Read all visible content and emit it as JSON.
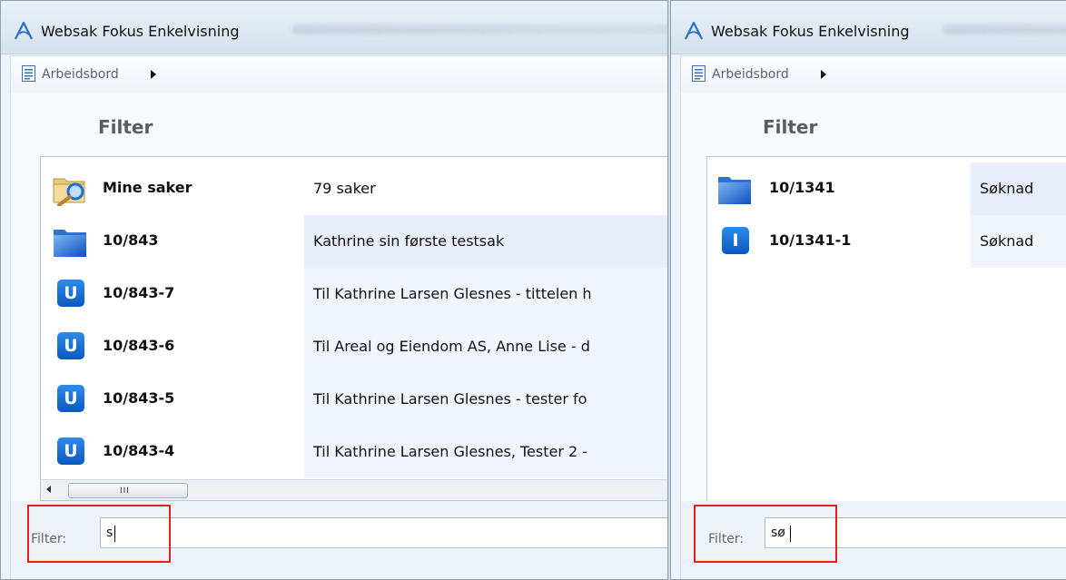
{
  "accent": "#e2231a",
  "left_window": {
    "title": "Websak Fokus Enkelvisning",
    "breadcrumb": "Arbeidsbord",
    "section_title": "Filter",
    "rows": [
      {
        "icon": "search-folder-icon",
        "number": "Mine saker",
        "description": "79 saker"
      },
      {
        "icon": "blue-folder-icon",
        "number": "10/843",
        "description": "Kathrine sin første testsak"
      },
      {
        "icon": "outgoing-document-icon",
        "badge": "U",
        "number": "10/843-7",
        "description": "Til Kathrine  Larsen Glesnes - tittelen h"
      },
      {
        "icon": "outgoing-document-icon",
        "badge": "U",
        "number": "10/843-6",
        "description": "Til Areal og Eiendom AS, Anne Lise - d"
      },
      {
        "icon": "outgoing-document-icon",
        "badge": "U",
        "number": "10/843-5",
        "description": "Til Kathrine  Larsen Glesnes - tester fo"
      },
      {
        "icon": "outgoing-document-icon",
        "badge": "U",
        "number": "10/843-4",
        "description": "Til Kathrine  Larsen Glesnes, Tester 2 -"
      }
    ],
    "scroll_grip": "III",
    "filter_label": "Filter:",
    "filter_value": "s"
  },
  "right_window": {
    "title": "Websak Fokus Enkelvisning",
    "breadcrumb": "Arbeidsbord",
    "section_title": "Filter",
    "rows": [
      {
        "icon": "blue-folder-icon",
        "number": "10/1341",
        "description": "Søknad"
      },
      {
        "icon": "incoming-document-icon",
        "badge": "I",
        "number": "10/1341-1",
        "description": "Søknad"
      }
    ],
    "filter_label": "Filter:",
    "filter_value": "sø"
  }
}
